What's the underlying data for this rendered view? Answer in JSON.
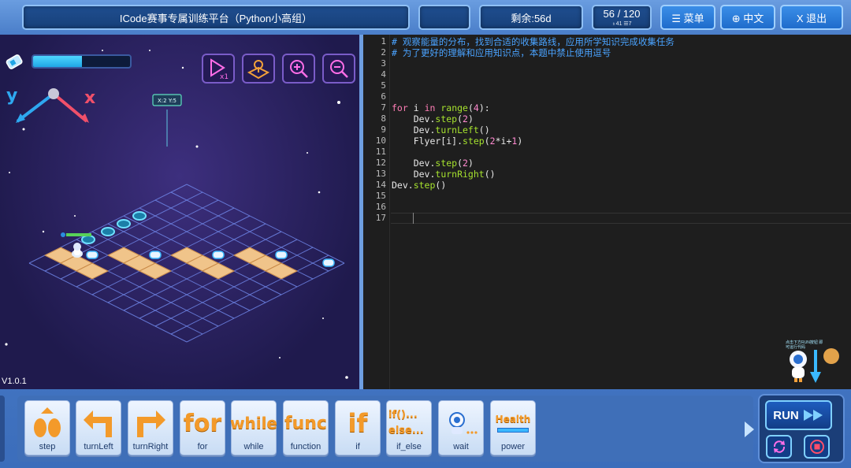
{
  "topbar": {
    "title": "ICode赛事专属训练平台（Python小高组）",
    "remaining": "剩余:56d",
    "progress": "56 / 120",
    "progress_sub": "♁41   ☰7",
    "menu_label": "☰ 菜单",
    "lang_label": "⊕ 中文",
    "exit_label": "X 退出"
  },
  "game": {
    "version": "V1.0.1",
    "energy_level": 0.5,
    "axis_x": "x",
    "axis_y": "y",
    "sign_label": "X:2 Y:5"
  },
  "editor": {
    "line_numbers": [
      "1",
      "2",
      "3",
      "4",
      "5",
      "6",
      "7",
      "8",
      "9",
      "10",
      "11",
      "12",
      "13",
      "14",
      "15",
      "16",
      "17"
    ],
    "lines": [
      "# 观察能量的分布，找到合适的收集路线，应用所学知识完成收集任务",
      "# 为了更好的理解和应用知识点，本题中禁止使用逗号",
      "",
      "",
      "",
      "",
      "for i in range(4):",
      "    Dev.step(2)",
      "    Dev.turnLeft()",
      "    Flyer[i].step(2*i+1)",
      "",
      "    Dev.step(2)",
      "    Dev.turnRight()",
      "Dev.step()",
      "",
      "",
      ""
    ],
    "hint": "点击下方RUN按钮 即可运行代码"
  },
  "palette": {
    "blocks": [
      {
        "label": "step",
        "icon": "step-icon"
      },
      {
        "label": "turnLeft",
        "icon": "turn-left-icon"
      },
      {
        "label": "turnRight",
        "icon": "turn-right-icon"
      },
      {
        "label": "for",
        "icon": "for"
      },
      {
        "label": "while",
        "icon": "while"
      },
      {
        "label": "function",
        "icon": "func"
      },
      {
        "label": "if",
        "icon": "if"
      },
      {
        "label": "if_else",
        "icon": "if()... else..."
      },
      {
        "label": "wait",
        "icon": "wait-icon"
      },
      {
        "label": "power",
        "icon": "Health"
      }
    ],
    "run_label": "RUN"
  },
  "colors": {
    "accent": "#1f6ccc",
    "code_comment": "#4aa3ff",
    "code_keyword": "#ff7eb6",
    "code_builtin": "#a6e22e",
    "energy": "#4fd6ff"
  }
}
